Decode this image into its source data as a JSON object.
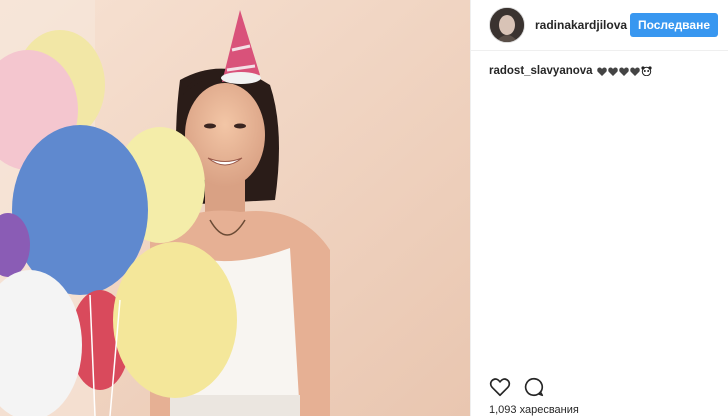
{
  "post": {
    "username": "radinakardjilova",
    "follow_label": "Последване",
    "caption": {
      "user": "radost_slavyanova",
      "emoji_icons": [
        "gray-heart-icon",
        "gray-heart-icon",
        "gray-heart-icon",
        "gray-heart-icon",
        "panda-face-icon"
      ]
    },
    "likes_text": "1,093 харесвания",
    "accent_color": "#3897f0"
  },
  "actions": {
    "like_icon": "heart-outline-icon",
    "comment_icon": "comment-bubble-icon"
  },
  "photo": {
    "subject": "birthday-portrait-photo"
  }
}
